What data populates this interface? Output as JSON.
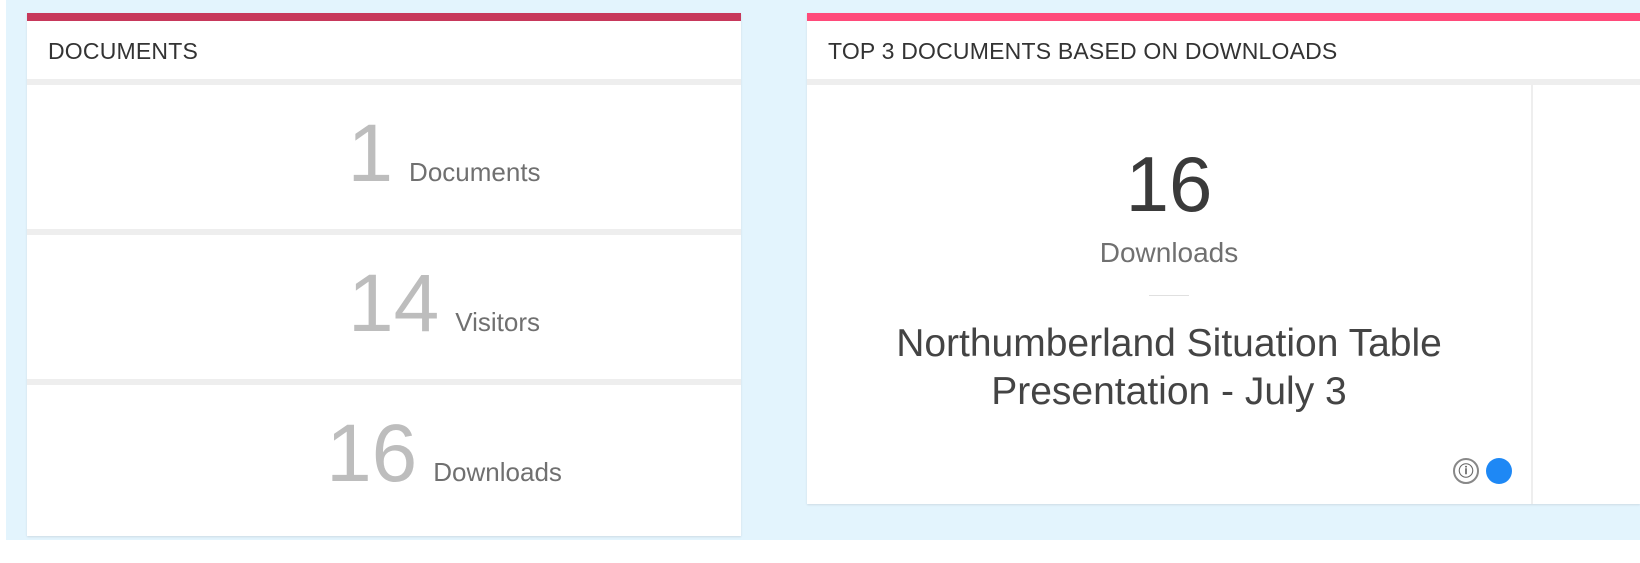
{
  "documents_panel": {
    "title": "DOCUMENTS",
    "stats": [
      {
        "value": "1",
        "label": "Documents"
      },
      {
        "value": "14",
        "label": "Visitors"
      },
      {
        "value": "16",
        "label": "Downloads"
      }
    ]
  },
  "top_panel": {
    "title": "TOP 3 DOCUMENTS BASED ON DOWNLOADS",
    "cards": [
      {
        "count": "16",
        "count_label": "Downloads",
        "doc_title": "Northumberland Situation Table Presentation - July 3"
      }
    ],
    "info_icon": "ⓘ",
    "active_dot_color": "#1e88f5"
  },
  "colors": {
    "documents_accent": "#c7385b",
    "top_accent": "#ff4a7a",
    "background": "#e3f4fd"
  }
}
